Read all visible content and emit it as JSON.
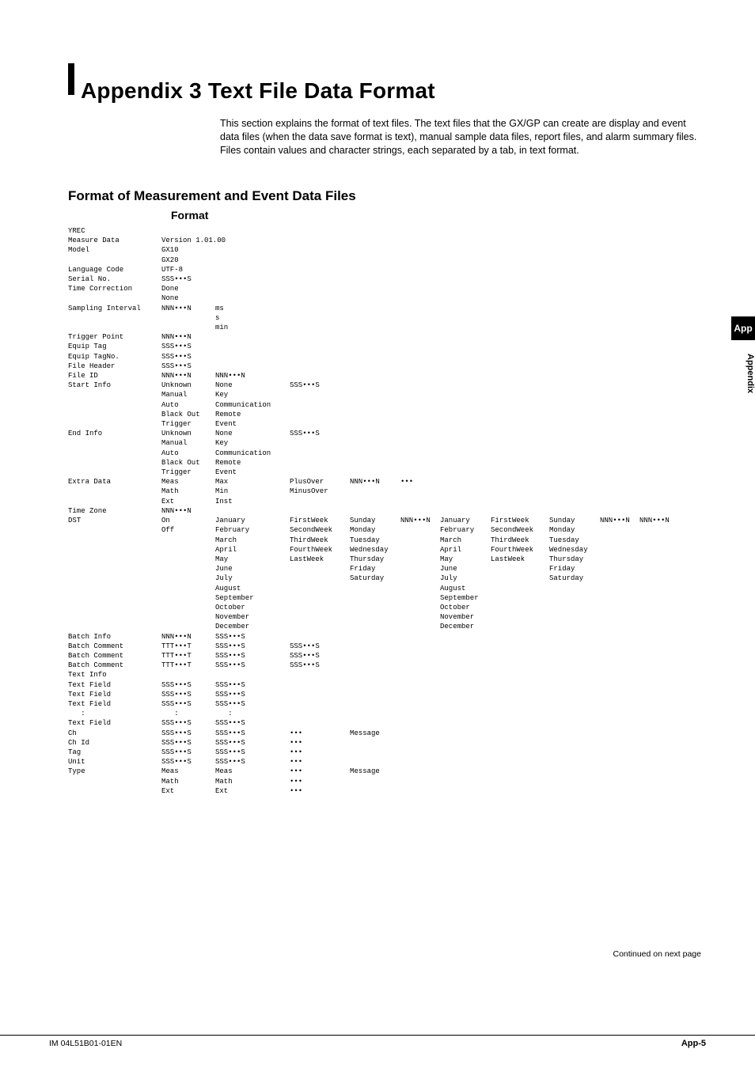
{
  "title": "Appendix  3   Text File Data Format",
  "intro_p1": "This section explains the format of text files. The text files that the GX/GP can create are display and event data files (when the data save format is text), manual sample data files, report files, and alarm summary files.",
  "intro_p2": "Files contain values and character strings, each separated by a tab, in text format.",
  "section": "Format of Measurement and Event Data Files",
  "format_label": "Format",
  "side_tab": "App",
  "side_text": "Appendix",
  "continued": "Continued on next page",
  "footer_left": "IM 04L51B01-01EN",
  "footer_right": "App-5",
  "rows": [
    [
      "YREC"
    ],
    [
      "Measure Data",
      "Version 1.01.00"
    ],
    [
      "Model",
      "GX10"
    ],
    [
      "",
      "GX20"
    ],
    [
      "Language Code",
      "UTF-8"
    ],
    [
      "Serial No.",
      "SSS•••S"
    ],
    [
      "Time Correction",
      "Done"
    ],
    [
      "",
      "None"
    ],
    [
      "Sampling Interval",
      "NNN•••N",
      "ms"
    ],
    [
      "",
      "",
      "s"
    ],
    [
      "",
      "",
      "min"
    ],
    [
      "Trigger Point",
      "NNN•••N"
    ],
    [
      "Equip Tag",
      "SSS•••S"
    ],
    [
      "Equip TagNo.",
      "SSS•••S"
    ],
    [
      "File Header",
      "SSS•••S"
    ],
    [
      "File ID",
      "NNN•••N",
      "NNN•••N"
    ],
    [
      "Start Info",
      "Unknown",
      "None",
      "SSS•••S"
    ],
    [
      "",
      "Manual",
      "Key"
    ],
    [
      "",
      "Auto",
      "Communication"
    ],
    [
      "",
      "Black Out",
      "Remote"
    ],
    [
      "",
      "Trigger",
      "Event"
    ],
    [
      "End Info",
      "Unknown",
      "None",
      "SSS•••S"
    ],
    [
      "",
      "Manual",
      "Key"
    ],
    [
      "",
      "Auto",
      "Communication"
    ],
    [
      "",
      "Black Out",
      "Remote"
    ],
    [
      "",
      "Trigger",
      "Event"
    ],
    [
      "Extra Data",
      "Meas",
      "Max",
      "PlusOver",
      "NNN•••N",
      "•••"
    ],
    [
      "",
      "Math",
      "Min",
      "MinusOver"
    ],
    [
      "",
      "Ext",
      "Inst"
    ],
    [
      "Time Zone",
      "NNN•••N"
    ],
    [
      "DST",
      "On",
      "January",
      "FirstWeek",
      "Sunday",
      "NNN•••N",
      "January",
      "FirstWeek",
      "Sunday",
      "NNN•••N",
      "NNN•••N"
    ],
    [
      "",
      "Off",
      "February",
      "SecondWeek",
      "Monday",
      "",
      "February",
      "SecondWeek",
      "Monday"
    ],
    [
      "",
      "",
      "March",
      "ThirdWeek",
      "Tuesday",
      "",
      "March",
      "ThirdWeek",
      "Tuesday"
    ],
    [
      "",
      "",
      "April",
      "FourthWeek",
      "Wednesday",
      "",
      "April",
      "FourthWeek",
      "Wednesday"
    ],
    [
      "",
      "",
      "May",
      "LastWeek",
      "Thursday",
      "",
      "May",
      "LastWeek",
      "Thursday"
    ],
    [
      "",
      "",
      "June",
      "",
      "Friday",
      "",
      "June",
      "",
      "Friday"
    ],
    [
      "",
      "",
      "July",
      "",
      "Saturday",
      "",
      "July",
      "",
      "Saturday"
    ],
    [
      "",
      "",
      "August",
      "",
      "",
      "",
      "August"
    ],
    [
      "",
      "",
      "September",
      "",
      "",
      "",
      "September"
    ],
    [
      "",
      "",
      "October",
      "",
      "",
      "",
      "October"
    ],
    [
      "",
      "",
      "November",
      "",
      "",
      "",
      "November"
    ],
    [
      "",
      "",
      "December",
      "",
      "",
      "",
      "December"
    ],
    [
      "Batch Info",
      "NNN•••N",
      "SSS•••S"
    ],
    [
      "Batch Comment",
      "TTT•••T",
      "SSS•••S",
      "SSS•••S"
    ],
    [
      "Batch Comment",
      "TTT•••T",
      "SSS•••S",
      "SSS•••S"
    ],
    [
      "Batch Comment",
      "TTT•••T",
      "SSS•••S",
      "SSS•••S"
    ],
    [
      "Text Info"
    ],
    [
      "Text Field",
      "SSS•••S",
      "SSS•••S"
    ],
    [
      "Text Field",
      "SSS•••S",
      "SSS•••S"
    ],
    [
      "Text Field",
      "SSS•••S",
      "SSS•••S"
    ],
    [
      "   :",
      "   :",
      "   :"
    ],
    [
      "Text Field",
      "SSS•••S",
      "SSS•••S"
    ],
    [
      "Ch",
      "SSS•••S",
      "SSS•••S",
      "•••",
      "Message"
    ],
    [
      "Ch Id",
      "SSS•••S",
      "SSS•••S",
      "•••"
    ],
    [
      "Tag",
      "SSS•••S",
      "SSS•••S",
      "•••"
    ],
    [
      "Unit",
      "SSS•••S",
      "SSS•••S",
      "•••"
    ],
    [
      "Type",
      "Meas",
      "Meas",
      "•••",
      "Message"
    ],
    [
      "",
      "Math",
      "Math",
      "•••"
    ],
    [
      "",
      "Ext",
      "Ext",
      "•••"
    ]
  ]
}
